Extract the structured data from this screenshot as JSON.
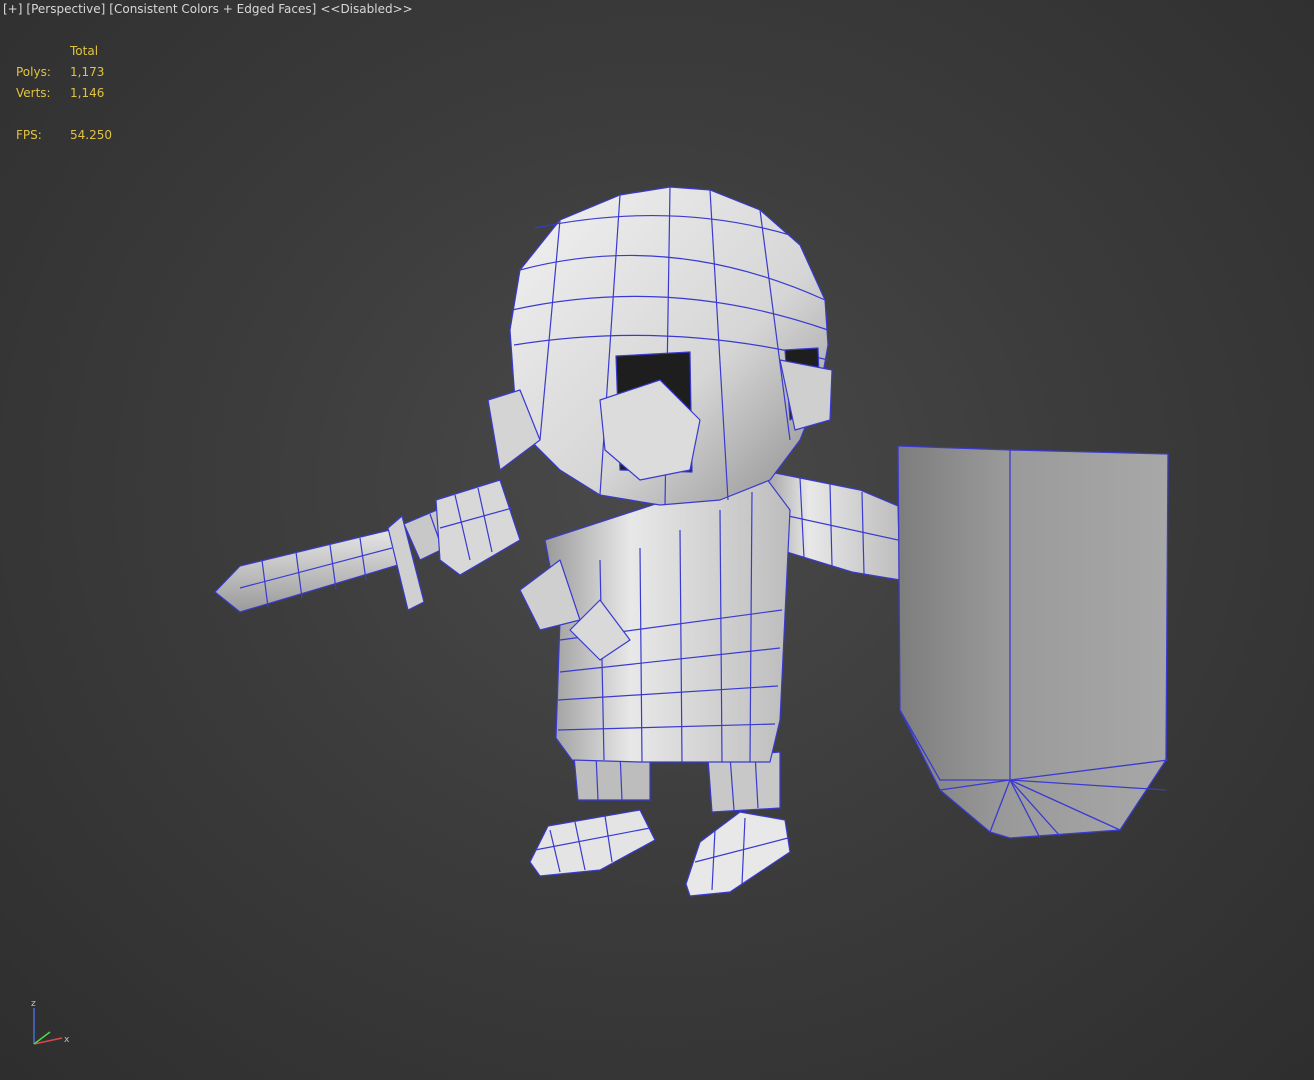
{
  "viewport_label": {
    "plus": "[+]",
    "view": "[Perspective]",
    "shading": "[Consistent Colors + Edged Faces]",
    "extra": "<<Disabled>>"
  },
  "stats": {
    "header": "Total",
    "polys_label": "Polys:",
    "polys_value": "1,173",
    "verts_label": "Verts:",
    "verts_value": "1,146",
    "fps_label": "FPS:",
    "fps_value": "54.250"
  },
  "gizmo": {
    "z": "z",
    "x": "x"
  },
  "colors": {
    "background": "#3c3c3c",
    "stats_text": "#e0c341",
    "wire": "#3a3ad0",
    "mesh_light": "#e6e6e6",
    "mesh_dark": "#8a8a8a"
  },
  "icons": {
    "axis": "axis-tripod-icon"
  }
}
